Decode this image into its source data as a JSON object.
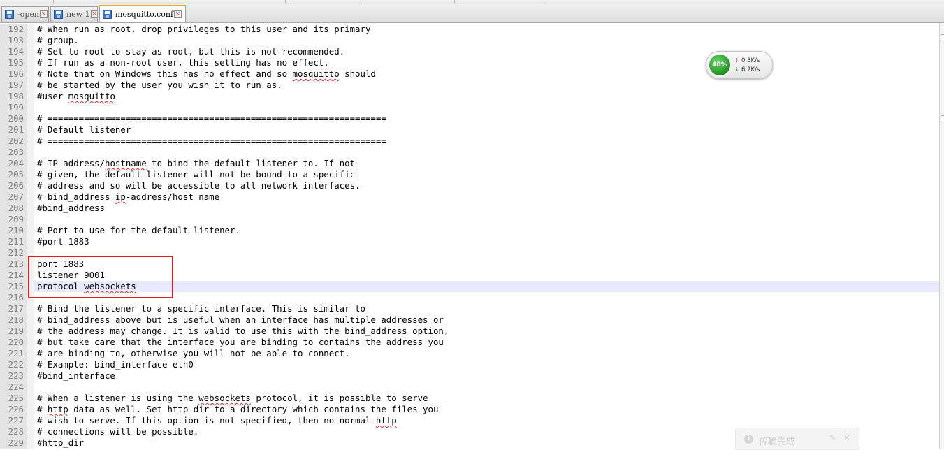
{
  "tabs": [
    {
      "label": "-open",
      "active": false,
      "icon": "save-icon"
    },
    {
      "label": "new 1",
      "active": false,
      "icon": "save-icon"
    },
    {
      "label": "mosquitto.conf",
      "active": true,
      "icon": "save-icon"
    }
  ],
  "tab_close_glyph": "×",
  "editor": {
    "current_line": 215,
    "highlight_box_lines": [
      213,
      214,
      215
    ],
    "lines": [
      {
        "num": "192",
        "text": "# When run as root, drop privileges to this user and its primary"
      },
      {
        "num": "193",
        "text": "# group."
      },
      {
        "num": "194",
        "text": "# Set to root to stay as root, but this is not recommended."
      },
      {
        "num": "195",
        "text": "# If run as a non-root user, this setting has no effect."
      },
      {
        "num": "196",
        "text": "# Note that on Windows this has no effect and so mosquitto should"
      },
      {
        "num": "197",
        "text": "# be started by the user you wish it to run as."
      },
      {
        "num": "198",
        "text": "#user mosquitto"
      },
      {
        "num": "199",
        "text": ""
      },
      {
        "num": "200",
        "text": "# ================================================================="
      },
      {
        "num": "201",
        "text": "# Default listener"
      },
      {
        "num": "202",
        "text": "# ================================================================="
      },
      {
        "num": "203",
        "text": ""
      },
      {
        "num": "204",
        "text": "# IP address/hostname to bind the default listener to. If not"
      },
      {
        "num": "205",
        "text": "# given, the default listener will not be bound to a specific"
      },
      {
        "num": "206",
        "text": "# address and so will be accessible to all network interfaces."
      },
      {
        "num": "207",
        "text": "# bind_address ip-address/host name"
      },
      {
        "num": "208",
        "text": "#bind_address"
      },
      {
        "num": "209",
        "text": ""
      },
      {
        "num": "210",
        "text": "# Port to use for the default listener."
      },
      {
        "num": "211",
        "text": "#port 1883"
      },
      {
        "num": "212",
        "text": ""
      },
      {
        "num": "213",
        "text": "port 1883"
      },
      {
        "num": "214",
        "text": "listener 9001"
      },
      {
        "num": "215",
        "text": "protocol websockets"
      },
      {
        "num": "216",
        "text": ""
      },
      {
        "num": "217",
        "text": "# Bind the listener to a specific interface. This is similar to"
      },
      {
        "num": "218",
        "text": "# bind_address above but is useful when an interface has multiple addresses or"
      },
      {
        "num": "219",
        "text": "# the address may change. It is valid to use this with the bind_address option,"
      },
      {
        "num": "220",
        "text": "# but take care that the interface you are binding to contains the address you"
      },
      {
        "num": "221",
        "text": "# are binding to, otherwise you will not be able to connect."
      },
      {
        "num": "222",
        "text": "# Example: bind_interface eth0"
      },
      {
        "num": "223",
        "text": "#bind_interface"
      },
      {
        "num": "224",
        "text": ""
      },
      {
        "num": "225",
        "text": "# When a listener is using the websockets protocol, it is possible to serve"
      },
      {
        "num": "226",
        "text": "# http data as well. Set http_dir to a directory which contains the files you"
      },
      {
        "num": "227",
        "text": "# wish to serve. If this option is not specified, then no normal http"
      },
      {
        "num": "228",
        "text": "# connections will be possible."
      },
      {
        "num": "229",
        "text": "#http_dir"
      }
    ],
    "spellcheck_words": [
      "mosquitto",
      "hostname",
      "ip",
      "websockets",
      "http"
    ]
  },
  "net_monitor": {
    "percent": "40%",
    "upload": "0.3K/s",
    "download": "6.2K/s",
    "up_icon": "arrow-up-icon",
    "down_icon": "arrow-down-icon",
    "up_color": "#e03030",
    "down_color": "#2a9a2a"
  },
  "toast": {
    "message": "传输完成",
    "icon": "info-icon"
  },
  "colors": {
    "highlight_box": "#e02020",
    "current_line_bg": "#e8e8ff",
    "active_tab_accent": "#f5a623"
  }
}
